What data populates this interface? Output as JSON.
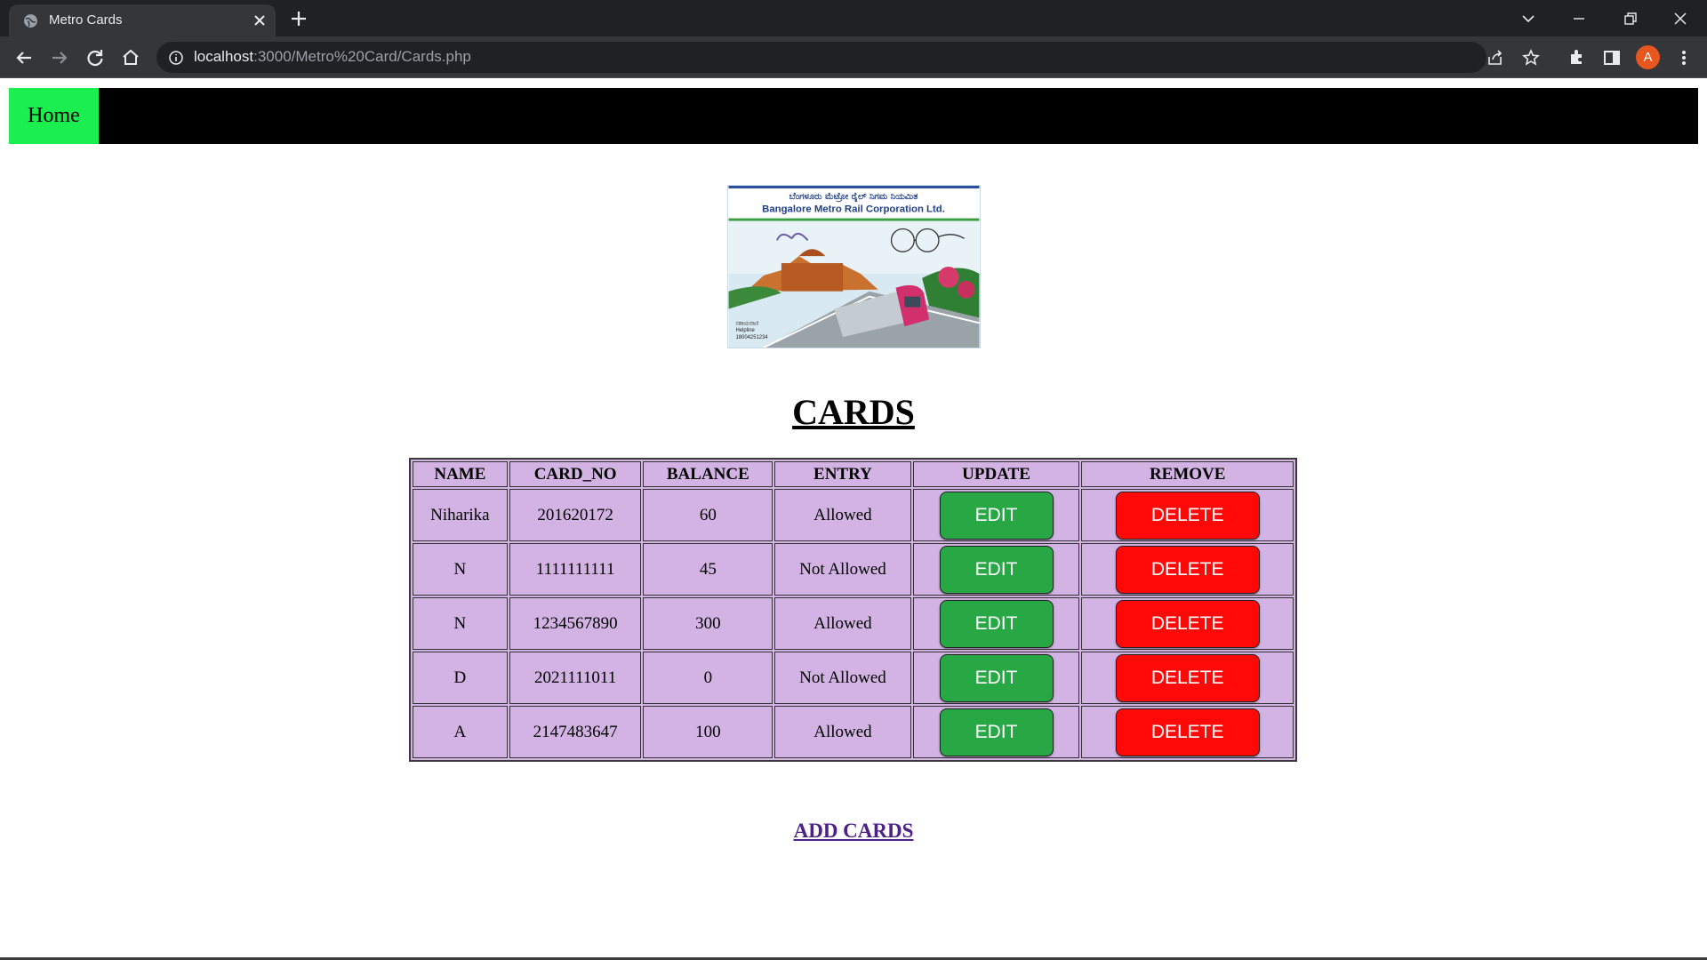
{
  "browser": {
    "tab_title": "Metro Cards",
    "url_host": "localhost",
    "url_path": ":3000/Metro%20Card/Cards.php",
    "profile_initial": "A"
  },
  "nav": {
    "home_label": "Home"
  },
  "logo": {
    "kannada_title": "ಬೆಂಗಳೂರು ಮೆಟ್ರೋ ರೈಲ್ ನಿಗಮ ನಿಯಮಿತ",
    "english_title": "Bangalore Metro Rail Corporation Ltd."
  },
  "page": {
    "title": "CARDS",
    "add_link": "ADD CARDS"
  },
  "table": {
    "headers": [
      "NAME",
      "CARD_NO",
      "BALANCE",
      "ENTRY",
      "UPDATE",
      "REMOVE"
    ],
    "edit_label": "EDIT",
    "delete_label": "DELETE",
    "rows": [
      {
        "name": "Niharika",
        "card_no": "201620172",
        "balance": "60",
        "entry": "Allowed"
      },
      {
        "name": "N",
        "card_no": "1111111111",
        "balance": "45",
        "entry": "Not Allowed"
      },
      {
        "name": "N",
        "card_no": "1234567890",
        "balance": "300",
        "entry": "Allowed"
      },
      {
        "name": "D",
        "card_no": "2021111011",
        "balance": "0",
        "entry": "Not Allowed"
      },
      {
        "name": "A",
        "card_no": "2147483647",
        "balance": "100",
        "entry": "Allowed"
      }
    ]
  },
  "colors": {
    "home_bg": "#1bee4f",
    "table_bg": "#d2b3e3",
    "edit_button": "#28a745",
    "delete_button": "#ff0808",
    "link": "#4d2188"
  }
}
